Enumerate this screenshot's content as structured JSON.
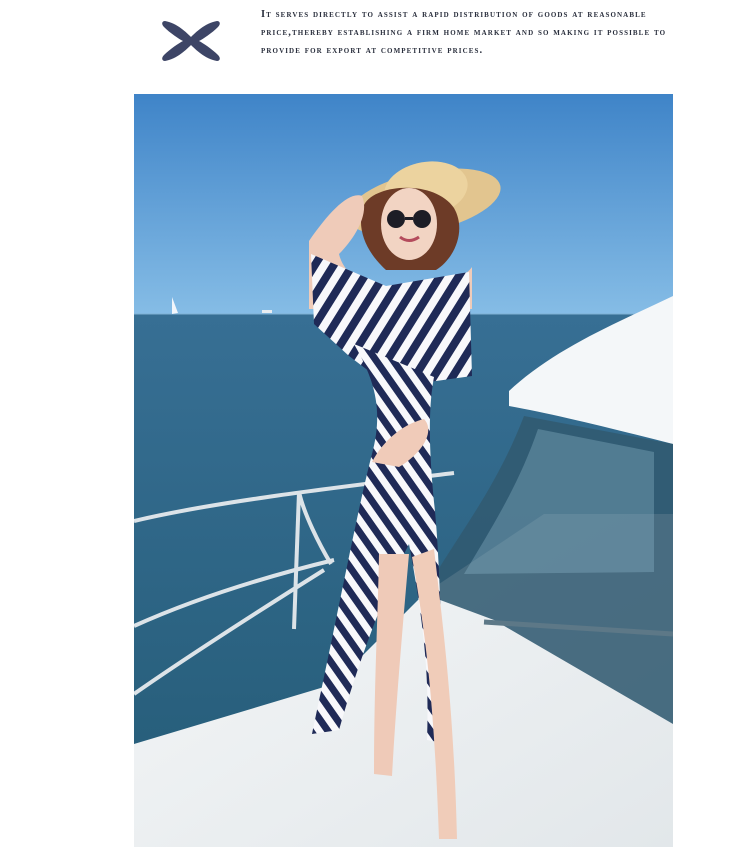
{
  "header": {
    "caption": "It serves directly to assist a rapid distribution of goods at reasonable price,thereby establishing a firm home market and so making it possible to provide for export at competitive prices.",
    "icon": "cross-icon",
    "icon_color": "#3d4566"
  },
  "photo": {
    "subject": "woman-in-striped-dress",
    "colors": {
      "sky": "#4a8fcf",
      "sea": "#2f6f8f",
      "boat": "#f4f6f7",
      "dress_stripe": "#1f2a57"
    }
  }
}
